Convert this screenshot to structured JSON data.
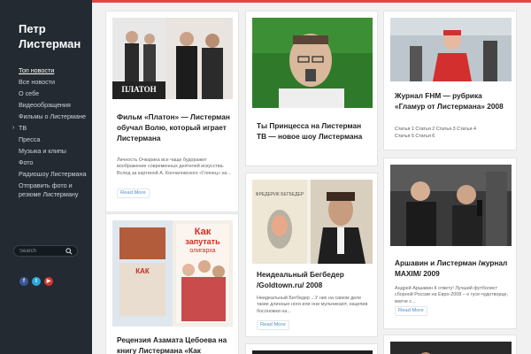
{
  "site": {
    "title_line1": "Петр",
    "title_line2": "Листерман"
  },
  "nav": [
    {
      "label": "Топ новости",
      "active": true
    },
    {
      "label": "Все новости"
    },
    {
      "label": "О себе"
    },
    {
      "label": "Видеообращения"
    },
    {
      "label": "Фильмы о Листермане"
    },
    {
      "label": "ТВ",
      "has_arrow": true
    },
    {
      "label": "Пресса"
    },
    {
      "label": "Музыка и клипы"
    },
    {
      "label": "Фото"
    },
    {
      "label": "Радиошоу Листермана"
    },
    {
      "label": "Отправить фото и резюме Листерману"
    }
  ],
  "search": {
    "placeholder": "Search"
  },
  "social": [
    "facebook-icon",
    "twitter-icon",
    "youtube-icon"
  ],
  "cards": {
    "platon": {
      "title": "Фильм «Платон» — Листерман обучал Волю, который играет Листермана",
      "excerpt": "Личность Очкарика все чаще будоражит воображение современных деятелей искусства. Вслед за картиной А. Кончаловского «Глянец» на...",
      "readmore": "Read More",
      "poster_title": "ПЛАТОН"
    },
    "princess": {
      "title": "Ты Принцесса на Листерман ТВ — новое шоу Листермана"
    },
    "fhm": {
      "title": "Журнал FHM — рубрика «Гламур от Листермана» 2008",
      "tags": [
        "Статья 1",
        "Статья 2",
        "Статья 3",
        "Статья 4",
        "Статья 5",
        "Статья 6"
      ]
    },
    "oligarch": {
      "title": "Рецензия Азамата Цебоева на книгу Листермана «Как",
      "cover_top": "Как",
      "cover_mid": "запутать",
      "cover_sub": "олигарха"
    },
    "begbeder": {
      "title": "Неидеальный Бегбедер /Goldtown.ru/ 2008",
      "excerpt": "Неидеальный Бегбедер ...У них на самом деле такие длинные ноги или они мульчикают, нацепив босоножки на...",
      "readmore": "Read More",
      "book_title": "ФРЕДЕРИК БЕГБЕДЕР"
    },
    "arshavin": {
      "title": "Аршавин и Листерман /журнал MAXIM/ 2009",
      "excerpt": "Андрей Аршавин К ответу!   Лучший футболист сборной России на Евро-2008 – о гусе-чудотворце, матче с...",
      "readmore": "Read More"
    }
  },
  "colors": {
    "accent": "#e04848",
    "sidebar": "#232a31",
    "link": "#4c8fd0"
  }
}
